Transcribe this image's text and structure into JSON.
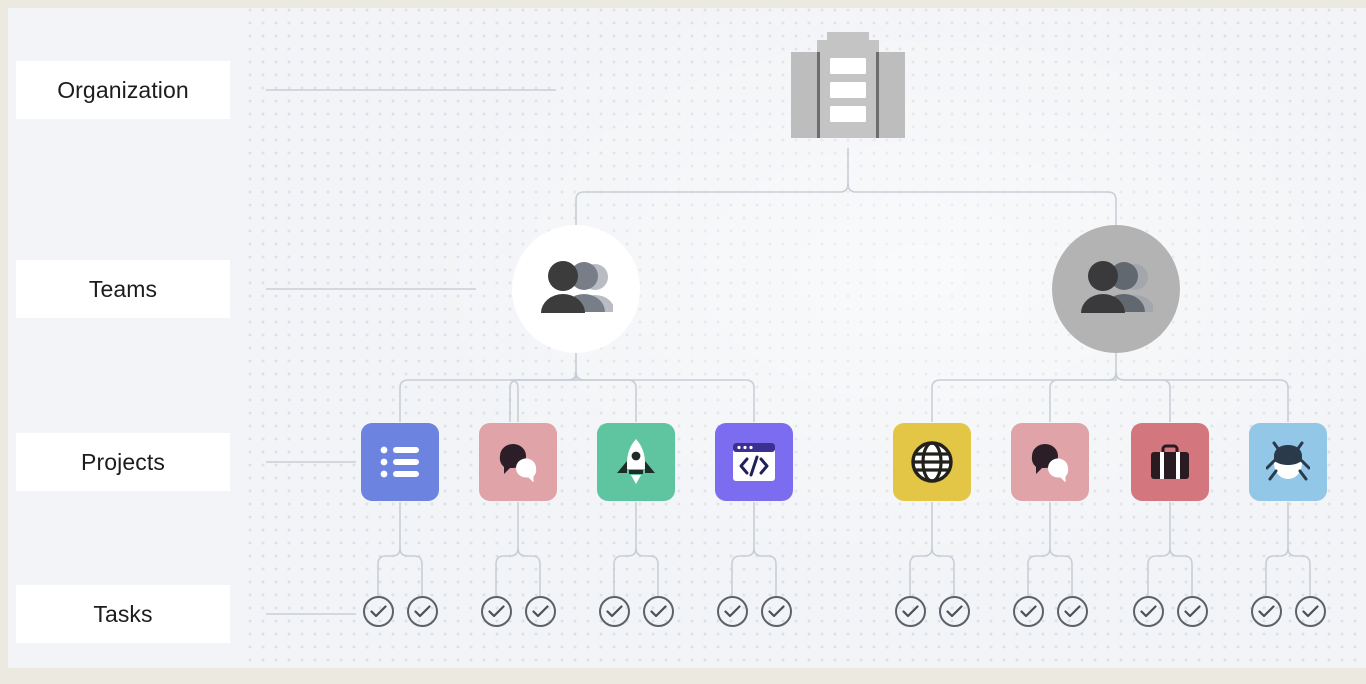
{
  "theme": {
    "outer_border": "#ece9e0",
    "canvas_bg": "#f2f4f7",
    "label_chip_bg": "#ffffff",
    "label_text": "#1c1c1e",
    "connector": "#c9ced6",
    "task_stroke": "#5b6269"
  },
  "row_labels": [
    {
      "text": "Organization",
      "name": "row-label-organization"
    },
    {
      "text": "Teams",
      "name": "row-label-teams"
    },
    {
      "text": "Projects",
      "name": "row-label-projects"
    },
    {
      "text": "Tasks",
      "name": "row-label-tasks"
    }
  ],
  "organization": {
    "icon": "office-building-icon",
    "colors": {
      "body": "#c4c4c4",
      "wings": "#bdbdbd",
      "slot": "#ffffff",
      "seam": "#6d6d6d"
    }
  },
  "teams": [
    {
      "icon": "people-group-icon",
      "circle_color": "#ffffff",
      "name": "team-node-1"
    },
    {
      "icon": "people-group-icon",
      "circle_color": "#b3b3b3",
      "name": "team-node-2"
    }
  ],
  "projects": [
    {
      "icon": "bulleted-list-icon",
      "color": "#6c83e0",
      "name": "project-tile-list",
      "team": 1
    },
    {
      "icon": "chat-bubbles-icon",
      "color": "#e0a3a8",
      "name": "project-tile-chat-1",
      "team": 1
    },
    {
      "icon": "rocket-icon",
      "color": "#5fc4a0",
      "name": "project-tile-rocket",
      "team": 1
    },
    {
      "icon": "code-window-icon",
      "color": "#7b6cf0",
      "name": "project-tile-code",
      "team": 1
    },
    {
      "icon": "globe-icon",
      "color": "#e3c646",
      "name": "project-tile-globe",
      "team": 2
    },
    {
      "icon": "chat-bubbles-icon",
      "color": "#e0a3a8",
      "name": "project-tile-chat-2",
      "team": 2
    },
    {
      "icon": "briefcase-icon",
      "color": "#d4767e",
      "name": "project-tile-briefcase",
      "team": 2
    },
    {
      "icon": "bug-icon",
      "color": "#92c7e8",
      "name": "project-tile-bug",
      "team": 2
    }
  ],
  "tasks": {
    "icon": "check-circle-icon",
    "count": 16,
    "per_project": 2
  },
  "chart_data": {
    "type": "diagram",
    "title": "Organization hierarchy",
    "levels": [
      "Organization",
      "Teams",
      "Projects",
      "Tasks"
    ],
    "counts": {
      "organization": 1,
      "teams": 2,
      "projects": 8,
      "tasks": 16
    }
  }
}
